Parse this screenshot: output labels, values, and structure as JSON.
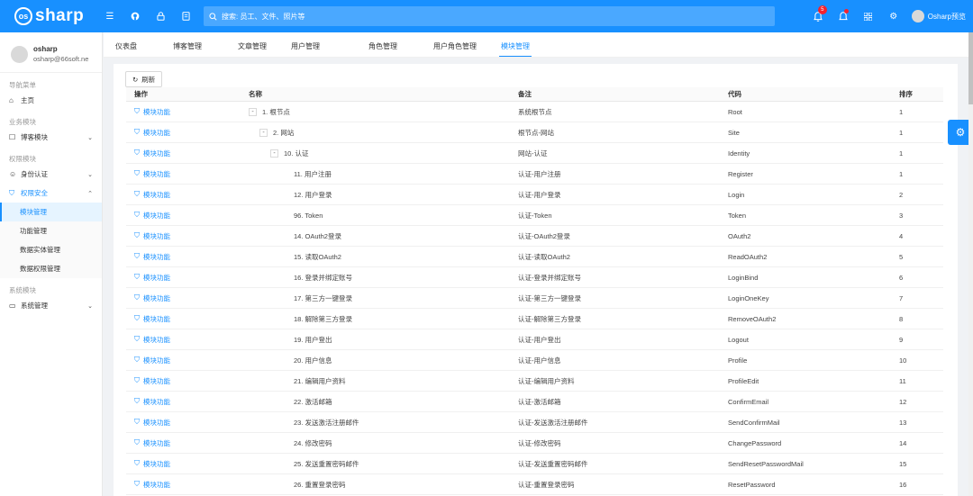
{
  "header": {
    "logo_mark": "os",
    "logo_text": "sharp",
    "search_placeholder": "搜索: 员工、文件、照片等",
    "notif_count": "5",
    "user_name": "Osharp预览",
    "icons": [
      "menu-icon",
      "github-icon",
      "lock-icon",
      "document-icon",
      "search-icon",
      "bell-icon",
      "notification-icon",
      "apps-icon",
      "gear-icon"
    ]
  },
  "sidebar": {
    "profile": {
      "name": "osharp",
      "email": "osharp@66soft.ne"
    },
    "nav_title": "导航菜单",
    "home": "主页",
    "group_business": "业务模块",
    "blog": "博客模块",
    "group_auth": "权限模块",
    "identity": "身份认证",
    "security": "权限安全",
    "security_items": [
      "模块管理",
      "功能管理",
      "数据实体管理",
      "数据权限管理"
    ],
    "group_system": "系统模块",
    "system": "系统管理"
  },
  "tabs": [
    "仪表盘",
    "博客管理",
    "文章管理",
    "用户管理",
    "角色管理",
    "用户角色管理",
    "模块管理"
  ],
  "active_tab": 6,
  "toolbar": {
    "refresh": "刷新"
  },
  "table": {
    "columns": [
      "操作",
      "名称",
      "备注",
      "代码",
      "排序"
    ],
    "op_label": "模块功能",
    "rows": [
      {
        "level": 0,
        "toggle": "-",
        "name": "1. 根节点",
        "remark": "系统根节点",
        "code": "Root",
        "order": "1"
      },
      {
        "level": 1,
        "toggle": "-",
        "name": "2. 网站",
        "remark": "根节点-网站",
        "code": "Site",
        "order": "1"
      },
      {
        "level": 2,
        "toggle": "-",
        "name": "10. 认证",
        "remark": "网站-认证",
        "code": "Identity",
        "order": "1"
      },
      {
        "level": 3,
        "toggle": "",
        "name": "11. 用户注册",
        "remark": "认证-用户注册",
        "code": "Register",
        "order": "1"
      },
      {
        "level": 3,
        "toggle": "",
        "name": "12. 用户登录",
        "remark": "认证-用户登录",
        "code": "Login",
        "order": "2"
      },
      {
        "level": 3,
        "toggle": "",
        "name": "96. Token",
        "remark": "认证-Token",
        "code": "Token",
        "order": "3"
      },
      {
        "level": 3,
        "toggle": "",
        "name": "14. OAuth2登录",
        "remark": "认证-OAuth2登录",
        "code": "OAuth2",
        "order": "4"
      },
      {
        "level": 3,
        "toggle": "",
        "name": "15. 读取OAuth2",
        "remark": "认证-读取OAuth2",
        "code": "ReadOAuth2",
        "order": "5"
      },
      {
        "level": 3,
        "toggle": "",
        "name": "16. 登录并绑定账号",
        "remark": "认证-登录并绑定账号",
        "code": "LoginBind",
        "order": "6"
      },
      {
        "level": 3,
        "toggle": "",
        "name": "17. 第三方一键登录",
        "remark": "认证-第三方一键登录",
        "code": "LoginOneKey",
        "order": "7"
      },
      {
        "level": 3,
        "toggle": "",
        "name": "18. 解除第三方登录",
        "remark": "认证-解除第三方登录",
        "code": "RemoveOAuth2",
        "order": "8"
      },
      {
        "level": 3,
        "toggle": "",
        "name": "19. 用户登出",
        "remark": "认证-用户登出",
        "code": "Logout",
        "order": "9"
      },
      {
        "level": 3,
        "toggle": "",
        "name": "20. 用户信息",
        "remark": "认证-用户信息",
        "code": "Profile",
        "order": "10"
      },
      {
        "level": 3,
        "toggle": "",
        "name": "21. 编辑用户资料",
        "remark": "认证-编辑用户资料",
        "code": "ProfileEdit",
        "order": "11"
      },
      {
        "level": 3,
        "toggle": "",
        "name": "22. 激活邮箱",
        "remark": "认证-激活邮箱",
        "code": "ConfirmEmail",
        "order": "12"
      },
      {
        "level": 3,
        "toggle": "",
        "name": "23. 发送激活注册邮件",
        "remark": "认证-发送激活注册邮件",
        "code": "SendConfirmMail",
        "order": "13"
      },
      {
        "level": 3,
        "toggle": "",
        "name": "24. 修改密码",
        "remark": "认证-修改密码",
        "code": "ChangePassword",
        "order": "14"
      },
      {
        "level": 3,
        "toggle": "",
        "name": "25. 发送重置密码邮件",
        "remark": "认证-发送重置密码邮件",
        "code": "SendResetPasswordMail",
        "order": "15"
      },
      {
        "level": 3,
        "toggle": "",
        "name": "26. 重置登录密码",
        "remark": "认证-重置登录密码",
        "code": "ResetPassword",
        "order": "16"
      }
    ]
  }
}
